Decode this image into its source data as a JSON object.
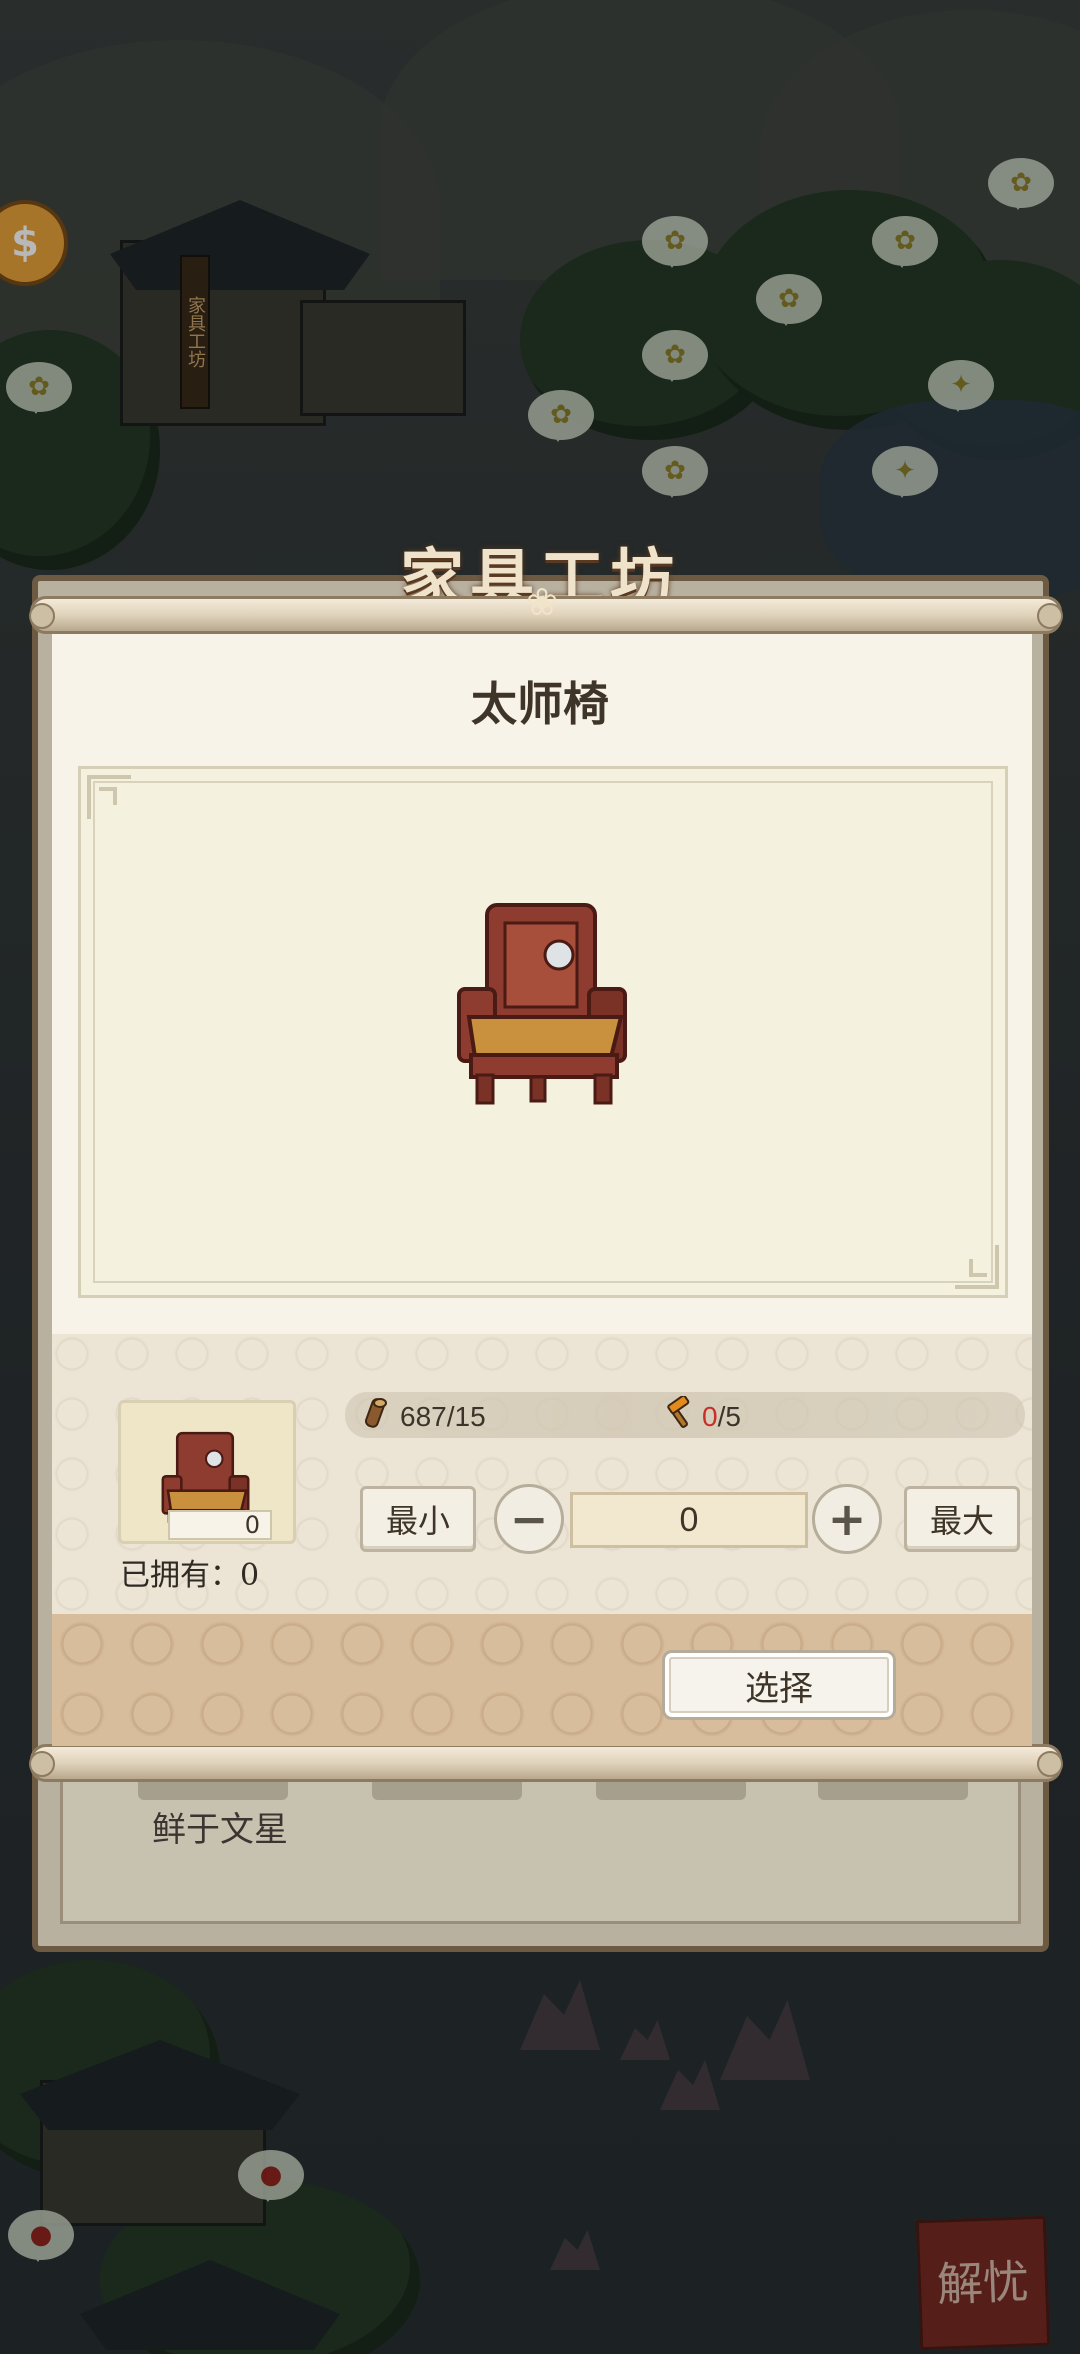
{
  "background": {
    "workshop_sign": "家具工坊",
    "workshop_title": "家具工坊",
    "worker_name": "鲜于文星",
    "seal_text": "解忧",
    "coin_icon": "coin-icon"
  },
  "dialog": {
    "title": "太师椅",
    "item_icon": "master-chair-icon",
    "owned_count": "0",
    "owned_label": "已拥有：0",
    "resources": {
      "wood_icon": "wood-log-icon",
      "wood_value": "687/15",
      "tool_icon": "hammer-icon",
      "tool_have": "0",
      "tool_need": "/5"
    },
    "controls": {
      "min_label": "最小",
      "max_label": "最大",
      "minus_label": "−",
      "plus_label": "+",
      "quantity": "0"
    },
    "select_label": "选择"
  },
  "colors": {
    "scroll_paper": "#f7f3e8",
    "footer": "#d8bd9c",
    "accent_red": "#c8302a",
    "tool_orange": "#e38a1d"
  }
}
